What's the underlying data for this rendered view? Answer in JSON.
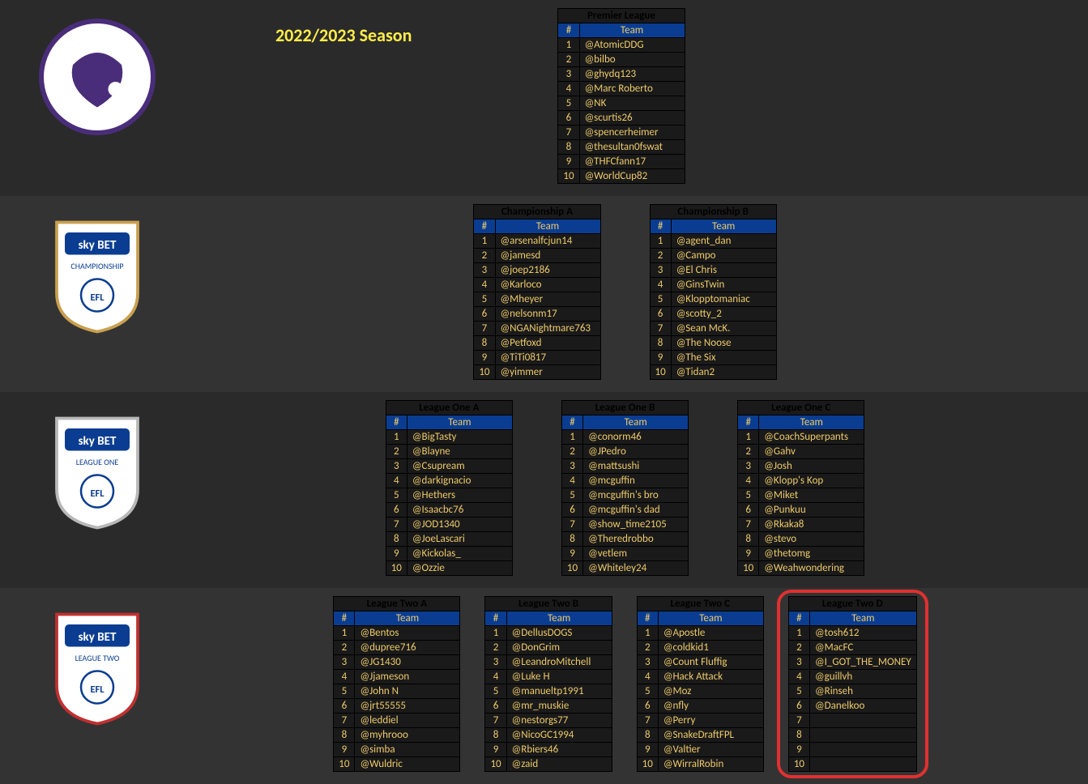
{
  "season_title": "2022/2023 Season",
  "headers": {
    "num": "#",
    "team": "Team"
  },
  "tiers": [
    {
      "logo": "premier-league-logo",
      "leagues": [
        {
          "name": "Premier League",
          "color": "title-premier",
          "teams": [
            "@AtomicDDG",
            "@bilbo",
            "@ghydq123",
            "@Marc Roberto",
            "@NK",
            "@scurtis26",
            "@spencerheimer",
            "@thesultan0fswat",
            "@THFCfann17",
            "@WorldCup82"
          ]
        }
      ]
    },
    {
      "logo": "championship-logo",
      "leagues": [
        {
          "name": "Championship A",
          "color": "title-champ",
          "teams": [
            "@arsenalfcjun14",
            "@jamesd",
            "@joep2186",
            "@Karloco",
            "@Mheyer",
            "@nelsonm17",
            "@NGANightmare763",
            "@Petfoxd",
            "@TiTi0817",
            "@yimmer"
          ]
        },
        {
          "name": "Championship B",
          "color": "title-champ",
          "teams": [
            "@agent_dan",
            "@Campo",
            "@El Chris",
            "@GinsTwin",
            "@Klopptomaniac",
            "@scotty_2",
            "@Sean McK.",
            "@The Noose",
            "@The Six",
            "@Tidan2"
          ]
        }
      ]
    },
    {
      "logo": "league-one-logo",
      "leagues": [
        {
          "name": "League One A",
          "color": "title-l1",
          "teams": [
            "@BigTasty",
            "@Blayne",
            "@Csupream",
            "@darkignacio",
            "@Hethers",
            "@Isaacbc76",
            "@JOD1340",
            "@JoeLascari",
            "@Kickolas_",
            "@Ozzie"
          ]
        },
        {
          "name": "League One B",
          "color": "title-l1",
          "teams": [
            "@conorm46",
            "@JPedro",
            "@mattsushi",
            "@mcguffin",
            "@mcguffin's bro",
            "@mcguffin's dad",
            "@show_time2105",
            "@Theredrobbo",
            "@vetlem",
            "@Whiteley24"
          ]
        },
        {
          "name": "League One C",
          "color": "title-l1",
          "teams": [
            "@CoachSuperpants",
            "@Gahv",
            "@Josh",
            "@Klopp's Kop",
            "@Miket",
            "@Punkuu",
            "@Rkaka8",
            "@stevo",
            "@thetomg",
            "@Weahwondering"
          ]
        }
      ]
    },
    {
      "logo": "league-two-logo",
      "leagues": [
        {
          "name": "League Two A",
          "color": "title-l2",
          "teams": [
            "@Bentos",
            "@dupree716",
            "@JG1430",
            "@Jjameson",
            "@John N",
            "@jrt55555",
            "@leddiel",
            "@myhrooo",
            "@simba",
            "@Wuldric"
          ]
        },
        {
          "name": "League Two B",
          "color": "title-l2",
          "teams": [
            "@DellusDOGS",
            "@DonGrim",
            "@LeandroMitchell",
            "@Luke H",
            "@manueltp1991",
            "@mr_muskie",
            "@nestorgs77",
            "@NicoGC1994",
            "@Rbiers46",
            "@zaid"
          ]
        },
        {
          "name": "League Two C",
          "color": "title-l2",
          "teams": [
            "@Apostle",
            "@coldkid1",
            "@Count Fluffig",
            "@Hack Attack",
            "@Moz",
            "@nfly",
            "@Perry",
            "@SnakeDraftFPL",
            "@Valtier",
            "@WirralRobin"
          ]
        },
        {
          "name": "League Two D",
          "color": "title-l2",
          "highlighted": true,
          "teams": [
            "@tosh612",
            "@MacFC",
            "@I_GOT_THE_MONEY",
            "@guillvh",
            "@Rinseh",
            "@Danelkoo",
            "",
            "",
            "",
            ""
          ]
        }
      ]
    }
  ]
}
